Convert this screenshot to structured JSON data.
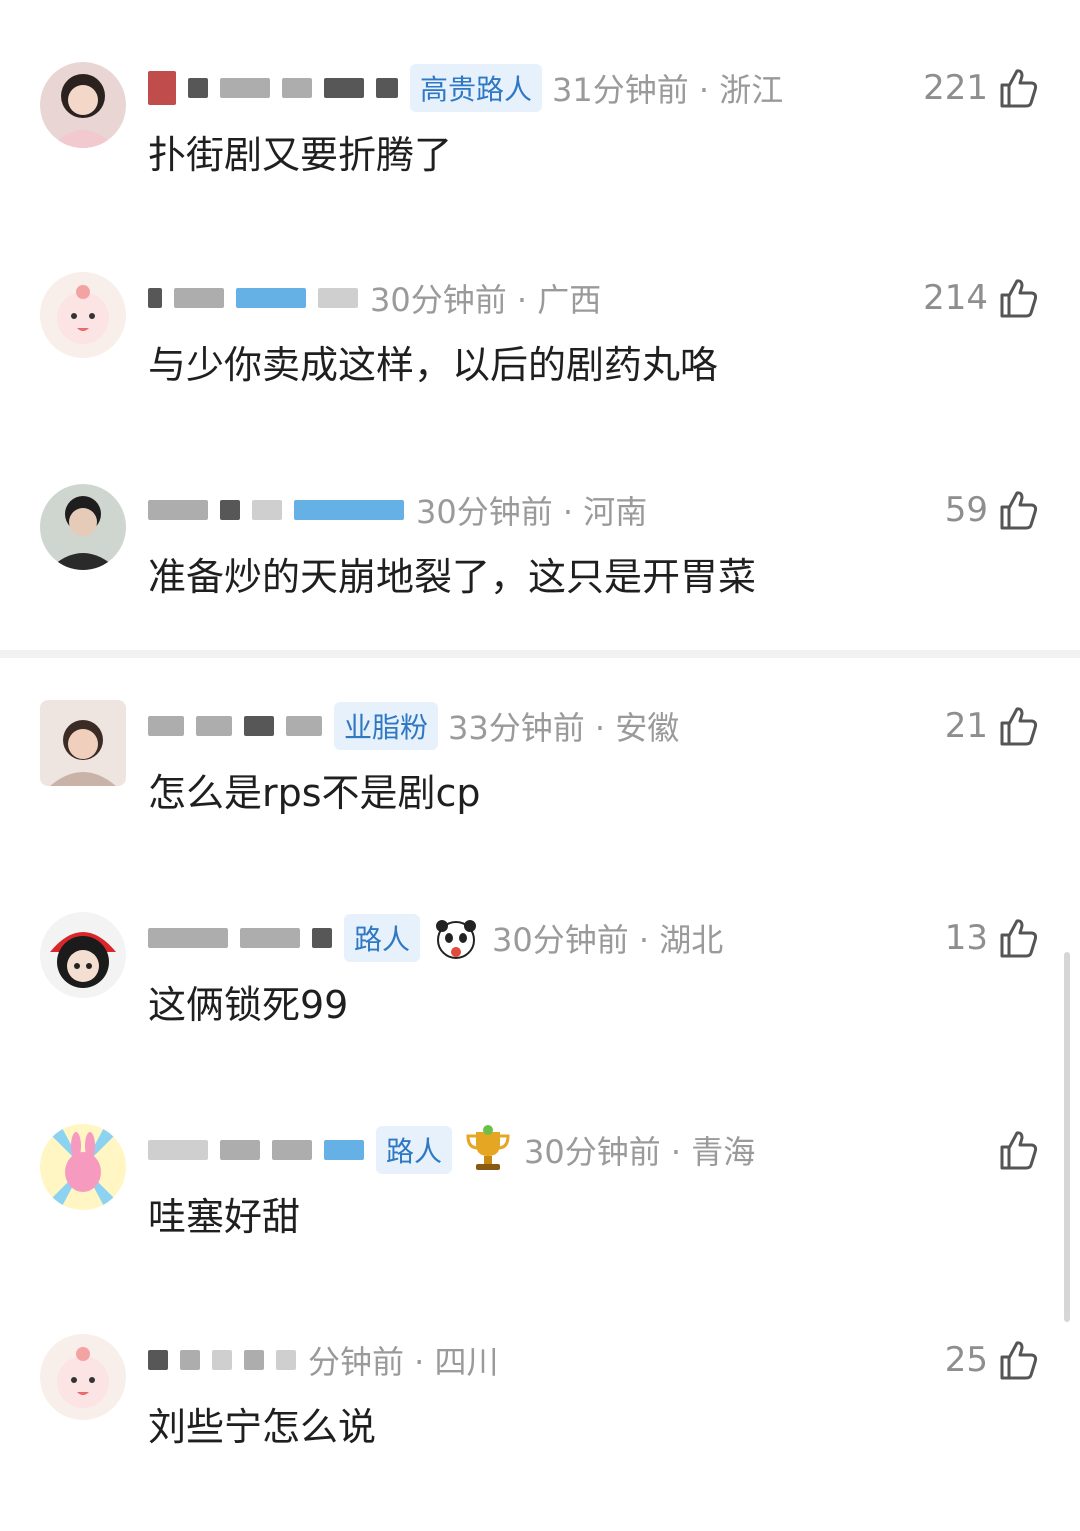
{
  "comments": [
    {
      "badge": "高贵路人",
      "time": "31分钟前 · 浙江",
      "likes": "221",
      "text": "扑街剧又要折腾了",
      "avatar": "avatar-girl-pink"
    },
    {
      "badge": "",
      "time": "30分钟前 · 广西",
      "likes": "214",
      "text": "与少你卖成这样，以后的剧药丸咯",
      "avatar": "avatar-cartoon-pink"
    },
    {
      "badge": "",
      "time": "30分钟前 · 河南",
      "likes": "59",
      "text": "准备炒的天崩地裂了，这只是开胃菜",
      "avatar": "avatar-boy"
    },
    {
      "badge": "业脂粉",
      "time": "33分钟前 · 安徽",
      "likes": "21",
      "text": "怎么是rps不是剧cp",
      "avatar": "avatar-woman"
    },
    {
      "badge": "路人",
      "time": "30分钟前 · 湖北",
      "likes": "13",
      "text": "这俩锁死99",
      "avatar": "avatar-dark-hat"
    },
    {
      "badge": "路人",
      "time": "30分钟前 · 青海",
      "likes": "",
      "text": "哇塞好甜",
      "avatar": "avatar-bunny"
    },
    {
      "badge": "",
      "time": "分钟前 · 四川",
      "likes": "25",
      "text": "刘些宁怎么说",
      "avatar": "avatar-cartoon-pink-2"
    }
  ],
  "colors": {
    "badge_bg": "#e7f1fb",
    "badge_text": "#2f78c4",
    "meta": "#9a9a9a"
  }
}
